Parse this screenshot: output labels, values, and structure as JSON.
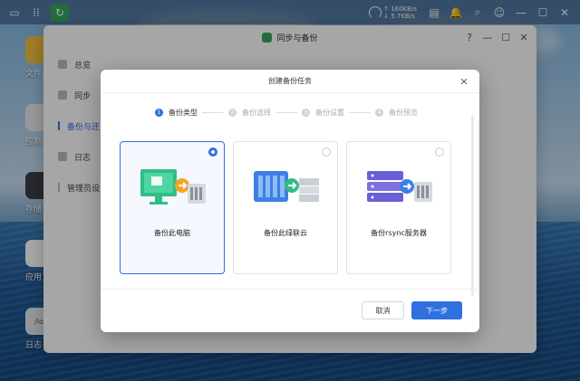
{
  "topbar": {
    "speed_up": "↑ 160KB/s",
    "speed_down": "↓ 5.7KB/s"
  },
  "desktop": {
    "items": [
      {
        "label": "文件"
      },
      {
        "label": "控制"
      },
      {
        "label": "存储"
      },
      {
        "label": "应用"
      },
      {
        "label": "日志"
      }
    ],
    "log_icon_text": "/lo"
  },
  "window": {
    "title": "同步与备份",
    "sidebar": [
      {
        "label": "总览"
      },
      {
        "label": "同步"
      },
      {
        "label": "备份与还"
      },
      {
        "label": "日志"
      },
      {
        "label": "管理员设"
      }
    ]
  },
  "dialog": {
    "title": "创建备份任务",
    "steps": [
      {
        "num": "1",
        "label": "备份类型"
      },
      {
        "num": "2",
        "label": "备份选择"
      },
      {
        "num": "3",
        "label": "备份设置"
      },
      {
        "num": "4",
        "label": "备份预览"
      }
    ],
    "cards": [
      {
        "label": "备份此电脑"
      },
      {
        "label": "备份此绿联云"
      },
      {
        "label": "备份rsync服务器"
      }
    ],
    "cancel_label": "取消",
    "next_label": "下一步"
  },
  "colors": {
    "accent": "#2f6fe0",
    "app_green": "#3aa562"
  }
}
